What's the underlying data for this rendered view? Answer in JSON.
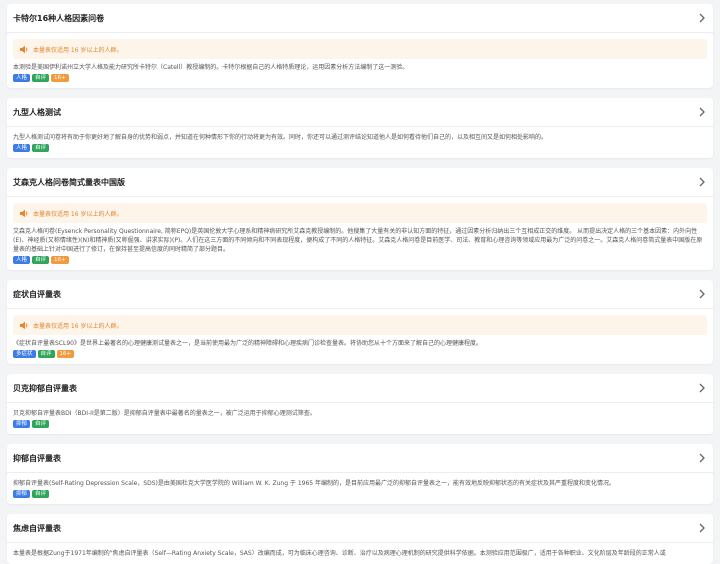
{
  "colors": {
    "tag_blue": "#3d7be6",
    "tag_green": "#2fa55b",
    "tag_orange": "#f19a3e",
    "notice_bg": "#fdf4ea",
    "notice_text": "#e6862c"
  },
  "cards": [
    {
      "title": "卡特尔16种人格因素问卷",
      "notice": "本量表仅适用 16 岁以上的人群。",
      "desc": "本测验是美国伊利诺州立大学人格及能力研究所卡特尔（Catell）教授编制的。卡特尔根据自己的人格特质理论，运用因素分析方法编制了这一测验。",
      "tags": [
        {
          "label": "人格",
          "color": "blue"
        },
        {
          "label": "自评",
          "color": "green"
        },
        {
          "label": "16+",
          "color": "orange"
        }
      ]
    },
    {
      "title": "九型人格测试",
      "notice": "",
      "desc": "九型人格测试问卷将有助于你更好地了解自身的优势和弱点，并知道在何种情形下你的行动将更为有效。同时，你还可以通过测评结论知道他人是如何看待他们自己的，以及相互间又是如何相处影响的。",
      "tags": [
        {
          "label": "人格",
          "color": "blue"
        },
        {
          "label": "自评",
          "color": "green"
        }
      ]
    },
    {
      "title": "艾森克人格问卷简式量表中国版",
      "notice": "本量表仅适用 16 岁以上的人群。",
      "desc": "艾森克人格问卷(Eysenck Personality Questionnaire, 简称EPQ)是英国伦敦大学心理系和精神病研究所艾森克教授编制的。他搜集了大量有关的非认知方面的特征，通过因素分析归纳出三个互相成正交的维度。 从而提出决定人格的三个基本因素：内外向性(E)、神经质(又称情绪性)(N)和精神质(又称倔强、讲求实际)(P)。人们在这三方面的不同倾向和不同表现程度，便构成了不同的人格特征。艾森克人格问卷是目前医学、司法、教育和心理咨询等领域应用最为广泛的问卷之一。艾森克人格问卷简式量表中国版在原量表的基础上针对中国进行了修订，在保持甚至提高信度的同时精简了部分题目。",
      "tags": [
        {
          "label": "人格",
          "color": "blue"
        },
        {
          "label": "自评",
          "color": "green"
        },
        {
          "label": "16+",
          "color": "orange"
        }
      ]
    },
    {
      "title": "症状自评量表",
      "notice": "本量表仅适用 16 岁以上的人群。",
      "desc": "《症状自评量表SCL90》是世界上最著名的心理健康测试量表之一，是当前使用最为广泛的精神障碍和心理疾病门诊检查量表。将协助您从十个方面来了解自己的心理健康程度。",
      "tags": [
        {
          "label": "多症状",
          "color": "blue"
        },
        {
          "label": "自评",
          "color": "green"
        },
        {
          "label": "16+",
          "color": "orange"
        }
      ]
    },
    {
      "title": "贝克抑郁自评量表",
      "notice": "",
      "desc": "贝克抑郁自评量表BDI（BDI-II是第二版）是抑郁自评量表中最著名的量表之一，被广泛运用于抑郁心理测试筛查。",
      "tags": [
        {
          "label": "抑郁",
          "color": "blue"
        },
        {
          "label": "自评",
          "color": "green"
        }
      ]
    },
    {
      "title": "抑郁自评量表",
      "notice": "",
      "desc": "抑郁自评量表(Self-Rating Depression Scale，SDS)是由美国杜克大学医学院的 William W. K. Zung 于 1965 年编制的，是目前应用最广泛的抑郁自评量表之一，能有效地反映抑郁状态的有关症状及其严重程度和变化情况。",
      "tags": [
        {
          "label": "抑郁",
          "color": "blue"
        },
        {
          "label": "自评",
          "color": "green"
        }
      ]
    },
    {
      "title": "焦虑自评量表",
      "notice": "",
      "desc": "本量表是根据Zung于1971年编制的\"焦虑自评量表（Self—Rating Anxiety Scale，SAS）改编而成，可为临床心理咨询、诊断、治疗以及病理心理机制的研究提供科学依据。本测验应用范围极广，适用于各种职业、文化阶层及年龄段的正常人或",
      "tags": []
    }
  ]
}
